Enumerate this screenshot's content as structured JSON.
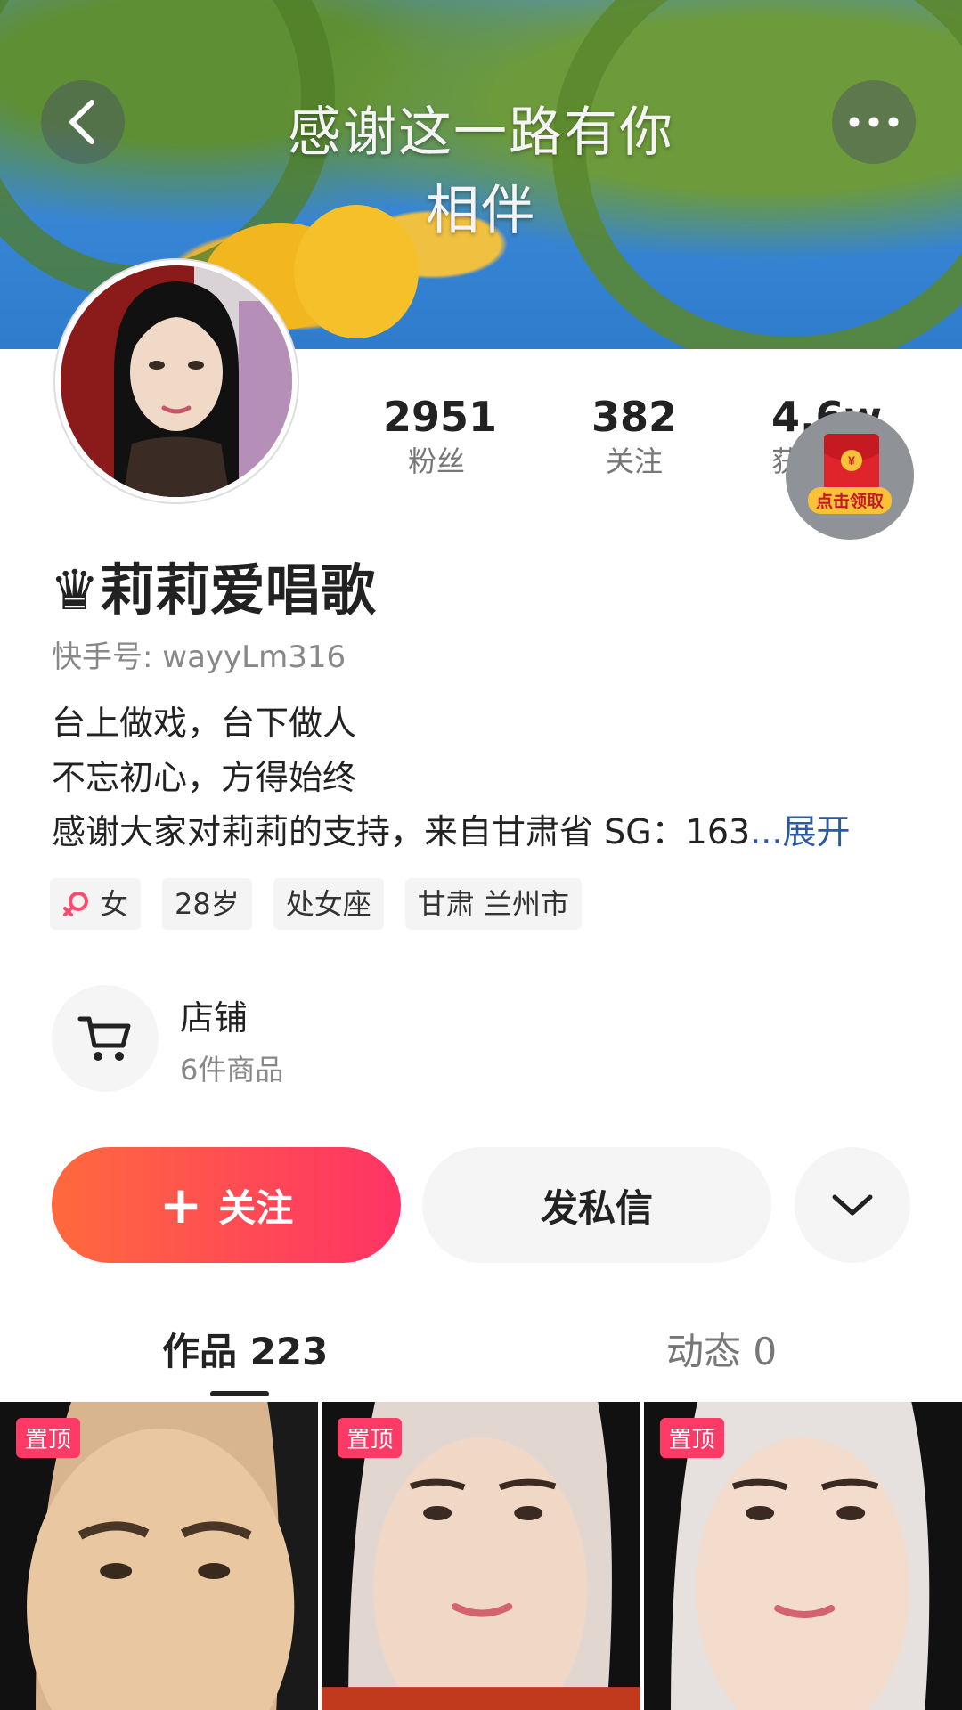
{
  "banner": {
    "text_line1": "感谢这一路有你",
    "text_line2": "相伴"
  },
  "nav": {
    "back_icon": "chevron-left-icon",
    "more_icon": "more-horizontal-icon"
  },
  "stats": [
    {
      "value": "2951",
      "label": "粉丝"
    },
    {
      "value": "382",
      "label": "关注"
    },
    {
      "value": "4.6w",
      "label": "获"
    }
  ],
  "red_packet": {
    "label": "点击领取",
    "symbol": "¥"
  },
  "profile": {
    "crown": "♛",
    "name": "莉莉爱唱歌",
    "kuaishou_id": "快手号: wayyLm316",
    "bio_lines": [
      "台上做戏，台下做人",
      "不忘初心，方得始终",
      "感谢大家对莉莉的支持，来自甘肃省 SG：163"
    ],
    "bio_ellipsis": "...",
    "bio_expand": "展开"
  },
  "tags": [
    {
      "text": "女",
      "icon": "female-icon"
    },
    {
      "text": "28岁"
    },
    {
      "text": "处女座"
    },
    {
      "text": "甘肃 兰州市"
    }
  ],
  "shop": {
    "title": "店铺",
    "subtitle": "6件商品"
  },
  "actions": {
    "follow_plus": "+",
    "follow": "关注",
    "message": "发私信"
  },
  "tabs": [
    {
      "label": "作品 223",
      "active": true
    },
    {
      "label": "动态 0",
      "active": false
    }
  ],
  "thumbnails": [
    {
      "badge": "置顶"
    },
    {
      "badge": "置顶"
    },
    {
      "badge": "置顶"
    }
  ],
  "colors": {
    "accent_start": "#ff6a3d",
    "accent_end": "#ff3366",
    "expand_link": "#2c5aa0",
    "pin_badge": "#ff3a66"
  }
}
